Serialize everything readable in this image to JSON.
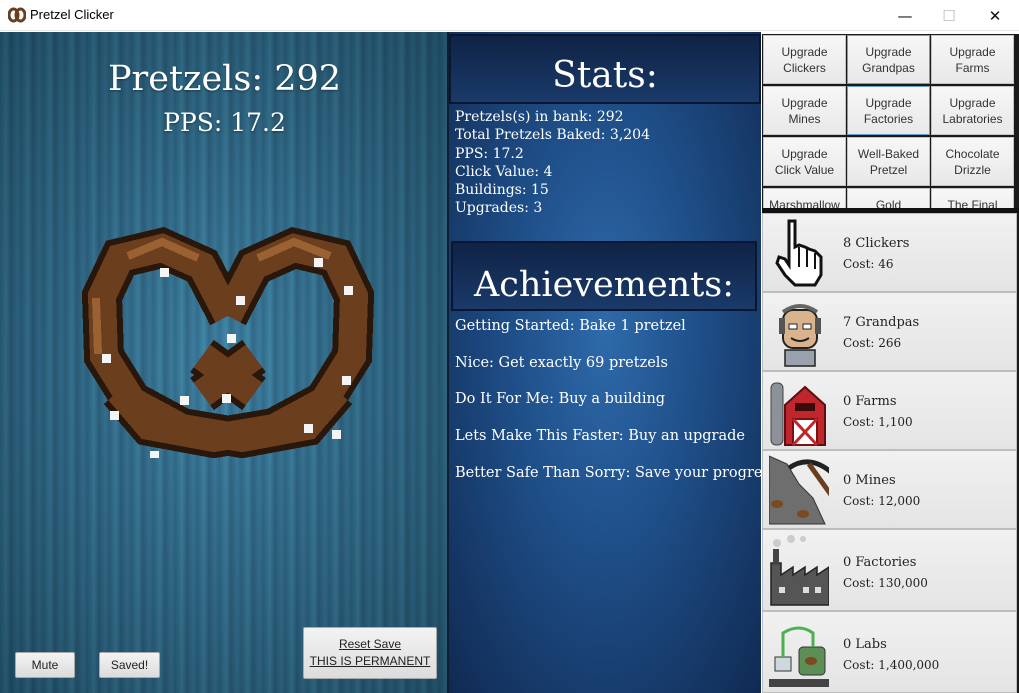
{
  "window": {
    "title": "Pretzel Clicker",
    "icon": "pretzel-app-icon",
    "controls": {
      "minimize": "—",
      "maximize": "☐",
      "close": "✕"
    }
  },
  "left": {
    "pretzels_label": "Pretzels: 292",
    "pps_label": "PPS: 17.2",
    "mute_label": "Mute",
    "saved_label": "Saved!",
    "reset_line1": "Reset Save",
    "reset_line2": "THIS IS PERMANENT"
  },
  "stats": {
    "heading": "Stats:",
    "lines": [
      "Pretzels(s) in bank: 292",
      "Total Pretzels Baked: 3,204",
      "PPS: 17.2",
      "Click Value: 4",
      "Buildings: 15",
      "Upgrades: 3"
    ]
  },
  "achievements": {
    "heading": "Achievements:",
    "items": [
      "Getting Started: Bake 1 pretzel",
      "Nice: Get exactly 69 pretzels",
      "Do It For Me: Buy a building",
      "Lets Make This Faster: Buy an upgrade",
      "Better Safe Than Sorry: Save your progress"
    ]
  },
  "upgrades": [
    {
      "line1": "Upgrade",
      "line2": "Clickers"
    },
    {
      "line1": "Upgrade",
      "line2": "Grandpas"
    },
    {
      "line1": "Upgrade",
      "line2": "Farms"
    },
    {
      "line1": "Upgrade",
      "line2": "Mines"
    },
    {
      "line1": "Upgrade",
      "line2": "Factories"
    },
    {
      "line1": "Upgrade",
      "line2": "Labratories"
    },
    {
      "line1": "Upgrade",
      "line2": "Click Value"
    },
    {
      "line1": "Well-Baked",
      "line2": "Pretzel"
    },
    {
      "line1": "Chocolate",
      "line2": "Drizzle"
    },
    {
      "line1": "Marshmallow",
      "line2": ""
    },
    {
      "line1": "Gold",
      "line2": ""
    },
    {
      "line1": "The Final",
      "line2": ""
    }
  ],
  "buildings": [
    {
      "name": "8 Clickers",
      "cost": "Cost: 46",
      "icon": "cursor-hand-icon"
    },
    {
      "name": "7 Grandpas",
      "cost": "Cost: 266",
      "icon": "grandpa-icon"
    },
    {
      "name": "0 Farms",
      "cost": "Cost: 1,100",
      "icon": "barn-icon"
    },
    {
      "name": "0 Mines",
      "cost": "Cost: 12,000",
      "icon": "pickaxe-icon"
    },
    {
      "name": "0 Factories",
      "cost": "Cost: 130,000",
      "icon": "factory-icon"
    },
    {
      "name": "0 Labs",
      "cost": "Cost: 1,400,000",
      "icon": "lab-flask-icon"
    }
  ],
  "colors": {
    "left_bg": "#2d6d8e",
    "mid_bg": "#1e4d86",
    "pretzel_brown": "#6b3f1d",
    "button_gray": "#e4e4e4"
  }
}
